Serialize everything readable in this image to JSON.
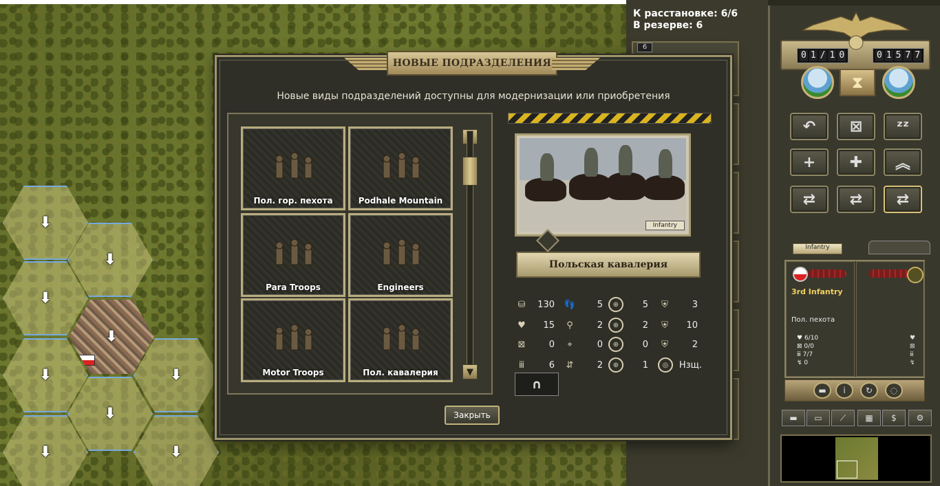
{
  "deploy": {
    "to_place": "К расстановке: 6/6",
    "in_reserve": "В резерве: 6",
    "slot_badge": "6"
  },
  "dialog": {
    "title": "НОВЫЕ ПОДРАЗДЕЛЕНИЯ",
    "subtitle": "Новые виды подразделений доступны для модернизации или приобретения",
    "close_label": "Закрыть",
    "units": [
      {
        "label": "Пол. гор. пехота"
      },
      {
        "label": "Podhale Mountain"
      },
      {
        "label": "Para Troops"
      },
      {
        "label": "Engineers"
      },
      {
        "label": "Motor Troops"
      },
      {
        "label": "Пол. кавалерия"
      }
    ],
    "selected": {
      "photo_tag": "Infantry",
      "name": "Польская кавалерия",
      "stats": [
        {
          "icon": "coins-icon",
          "value": "130"
        },
        {
          "icon": "footsteps-icon",
          "value": "5"
        },
        {
          "icon": "crosshair-soft-icon",
          "value": "5"
        },
        {
          "icon": "shield-tank-icon",
          "value": "3"
        },
        {
          "icon": "heart-icon",
          "value": "15"
        },
        {
          "icon": "binoculars-icon",
          "value": "2"
        },
        {
          "icon": "crosshair-hard-icon",
          "value": "2"
        },
        {
          "icon": "shield-infantry-icon",
          "value": "10"
        },
        {
          "icon": "fuel-icon",
          "value": "0"
        },
        {
          "icon": "artillery-target-icon",
          "value": "0"
        },
        {
          "icon": "crosshair-air-icon",
          "value": "0"
        },
        {
          "icon": "shield-air-icon",
          "value": "2"
        },
        {
          "icon": "ammo-icon",
          "value": "6"
        },
        {
          "icon": "range-icon",
          "value": "2"
        },
        {
          "icon": "crosshair-naval-icon",
          "value": "1"
        },
        {
          "icon": "initiative-icon",
          "value": "Нзщ."
        }
      ]
    }
  },
  "hud": {
    "turn_counter": [
      "0",
      "1",
      "/",
      "1",
      "0"
    ],
    "prestige_counter": [
      "0",
      "1",
      "5",
      "7",
      "7"
    ],
    "unit_tab": "Infantry",
    "unit": {
      "name": "3rd Infantry",
      "type": "Пол. пехота",
      "strength": "6/10",
      "fuel": "0/0",
      "ammo": "7/7",
      "experience": "0"
    }
  }
}
